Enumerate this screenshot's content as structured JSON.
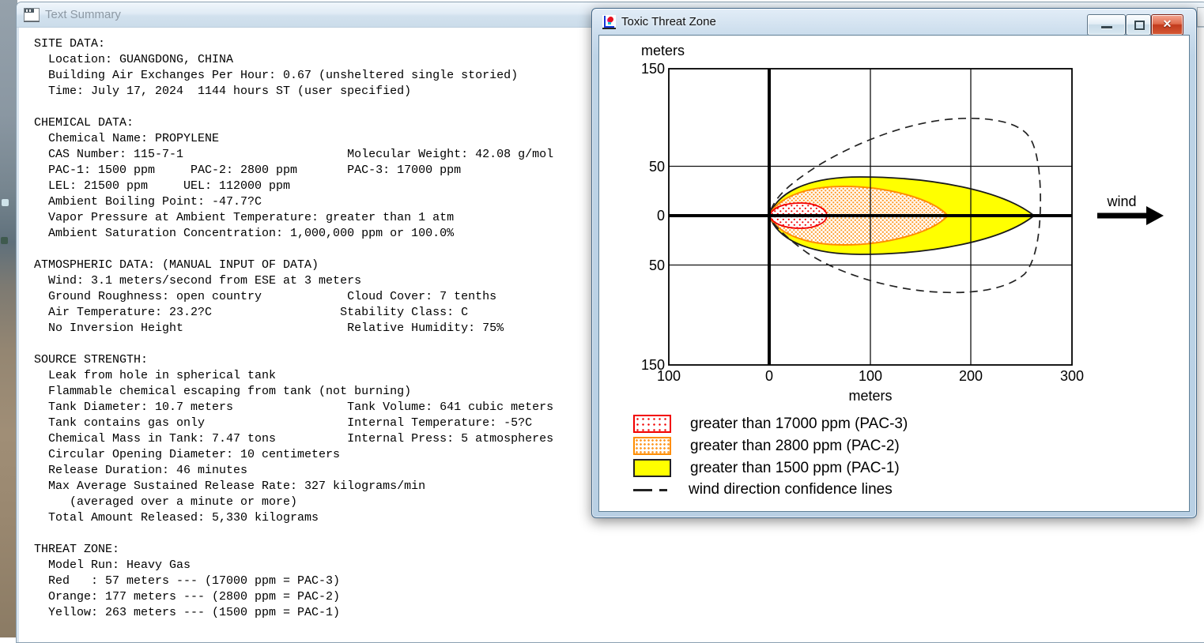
{
  "text_summary_window": {
    "title": "Text Summary",
    "summary_text": "SITE DATA:\n  Location: GUANGDONG, CHINA\n  Building Air Exchanges Per Hour: 0.67 (unsheltered single storied)\n  Time: July 17, 2024  1144 hours ST (user specified)\n\nCHEMICAL DATA:\n  Chemical Name: PROPYLENE\n  CAS Number: 115-7-1                       Molecular Weight: 42.08 g/mol\n  PAC-1: 1500 ppm     PAC-2: 2800 ppm       PAC-3: 17000 ppm\n  LEL: 21500 ppm     UEL: 112000 ppm\n  Ambient Boiling Point: -47.7?C\n  Vapor Pressure at Ambient Temperature: greater than 1 atm\n  Ambient Saturation Concentration: 1,000,000 ppm or 100.0%\n\nATMOSPHERIC DATA: (MANUAL INPUT OF DATA)\n  Wind: 3.1 meters/second from ESE at 3 meters\n  Ground Roughness: open country            Cloud Cover: 7 tenths\n  Air Temperature: 23.2?C                  Stability Class: C\n  No Inversion Height                       Relative Humidity: 75%\n\nSOURCE STRENGTH:\n  Leak from hole in spherical tank\n  Flammable chemical escaping from tank (not burning)\n  Tank Diameter: 10.7 meters                Tank Volume: 641 cubic meters\n  Tank contains gas only                    Internal Temperature: -5?C\n  Chemical Mass in Tank: 7.47 tons          Internal Press: 5 atmospheres\n  Circular Opening Diameter: 10 centimeters\n  Release Duration: 46 minutes\n  Max Average Sustained Release Rate: 327 kilograms/min\n     (averaged over a minute or more)\n  Total Amount Released: 5,330 kilograms\n\nTHREAT ZONE:\n  Model Run: Heavy Gas\n  Red   : 57 meters --- (17000 ppm = PAC-3)\n  Orange: 177 meters --- (2800 ppm = PAC-2)\n  Yellow: 263 meters --- (1500 ppm = PAC-1)"
  },
  "toxic_window": {
    "title": "Toxic Threat Zone"
  },
  "chart_data": {
    "type": "area",
    "title": "Toxic Threat Zone",
    "xlabel": "meters",
    "ylabel": "meters",
    "xlim": [
      -100,
      300
    ],
    "ylim": [
      -150,
      150
    ],
    "x_ticks": [
      "100",
      "0",
      "100",
      "200",
      "300"
    ],
    "y_ticks": [
      "150",
      "50",
      "0",
      "50",
      "150"
    ],
    "grid": "on",
    "wind_label": "wind",
    "zones": [
      {
        "name": "PAC-3",
        "threshold_ppm": 17000,
        "downwind_distance_m": 57,
        "max_half_width_m": 13,
        "color": "#f20000",
        "fill": "red-dots",
        "label": "greater than 17000 ppm (PAC-3)"
      },
      {
        "name": "PAC-2",
        "threshold_ppm": 2800,
        "downwind_distance_m": 177,
        "max_half_width_m": 30,
        "color": "#ff8d00",
        "fill": "orange-dots",
        "label": "greater than 2800 ppm (PAC-2)"
      },
      {
        "name": "PAC-1",
        "threshold_ppm": 1500,
        "downwind_distance_m": 263,
        "max_half_width_m": 39,
        "color": "#ffff00",
        "fill": "solid-yellow",
        "label": "greater than 1500 ppm (PAC-1)"
      }
    ],
    "confidence_lines": {
      "label": "wind direction confidence lines",
      "style": "dashed-black",
      "max_upper_extent_m": 95,
      "max_lower_extent_m": -80,
      "downwind_extent_m": 270
    },
    "legend_position": "below-plot"
  }
}
